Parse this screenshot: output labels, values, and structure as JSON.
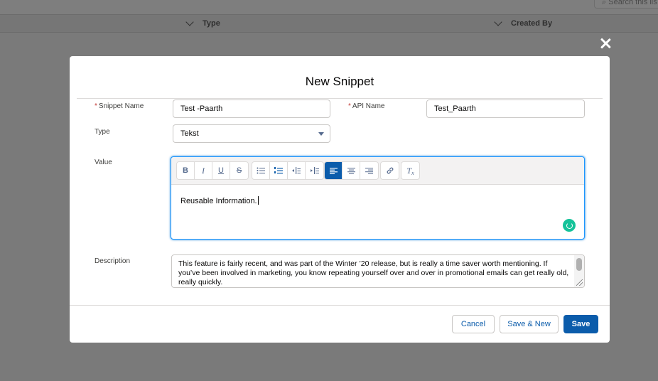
{
  "background": {
    "search_placeholder": "Search this lis",
    "columns": [
      {
        "label": "Type"
      },
      {
        "label": "Created By"
      }
    ]
  },
  "modal": {
    "title": "New Snippet",
    "fields": {
      "snippet_name": {
        "label": "Snippet Name",
        "value": "Test -Paarth",
        "required": true
      },
      "api_name": {
        "label": "API Name",
        "value": "Test_Paarth",
        "required": true
      },
      "type": {
        "label": "Type",
        "value": "Tekst"
      },
      "value": {
        "label": "Value",
        "content": "Reusable Information."
      },
      "description": {
        "label": "Description",
        "value": "This feature is fairly recent, and was part of the Winter ’20 release, but is really a time saver worth mentioning. If you’ve been involved in marketing, you know repeating yourself over and over in promotional emails can get really old, really quickly."
      }
    },
    "toolbar": {
      "bold": "B",
      "italic": "I",
      "underline": "U",
      "strike": "S",
      "clear": "T"
    },
    "buttons": {
      "cancel": "Cancel",
      "save_new": "Save & New",
      "save": "Save"
    }
  },
  "colors": {
    "brand": "#0b5cab",
    "required": "#c23934",
    "focus": "#1b96ff",
    "grammarly": "#15c39a"
  }
}
